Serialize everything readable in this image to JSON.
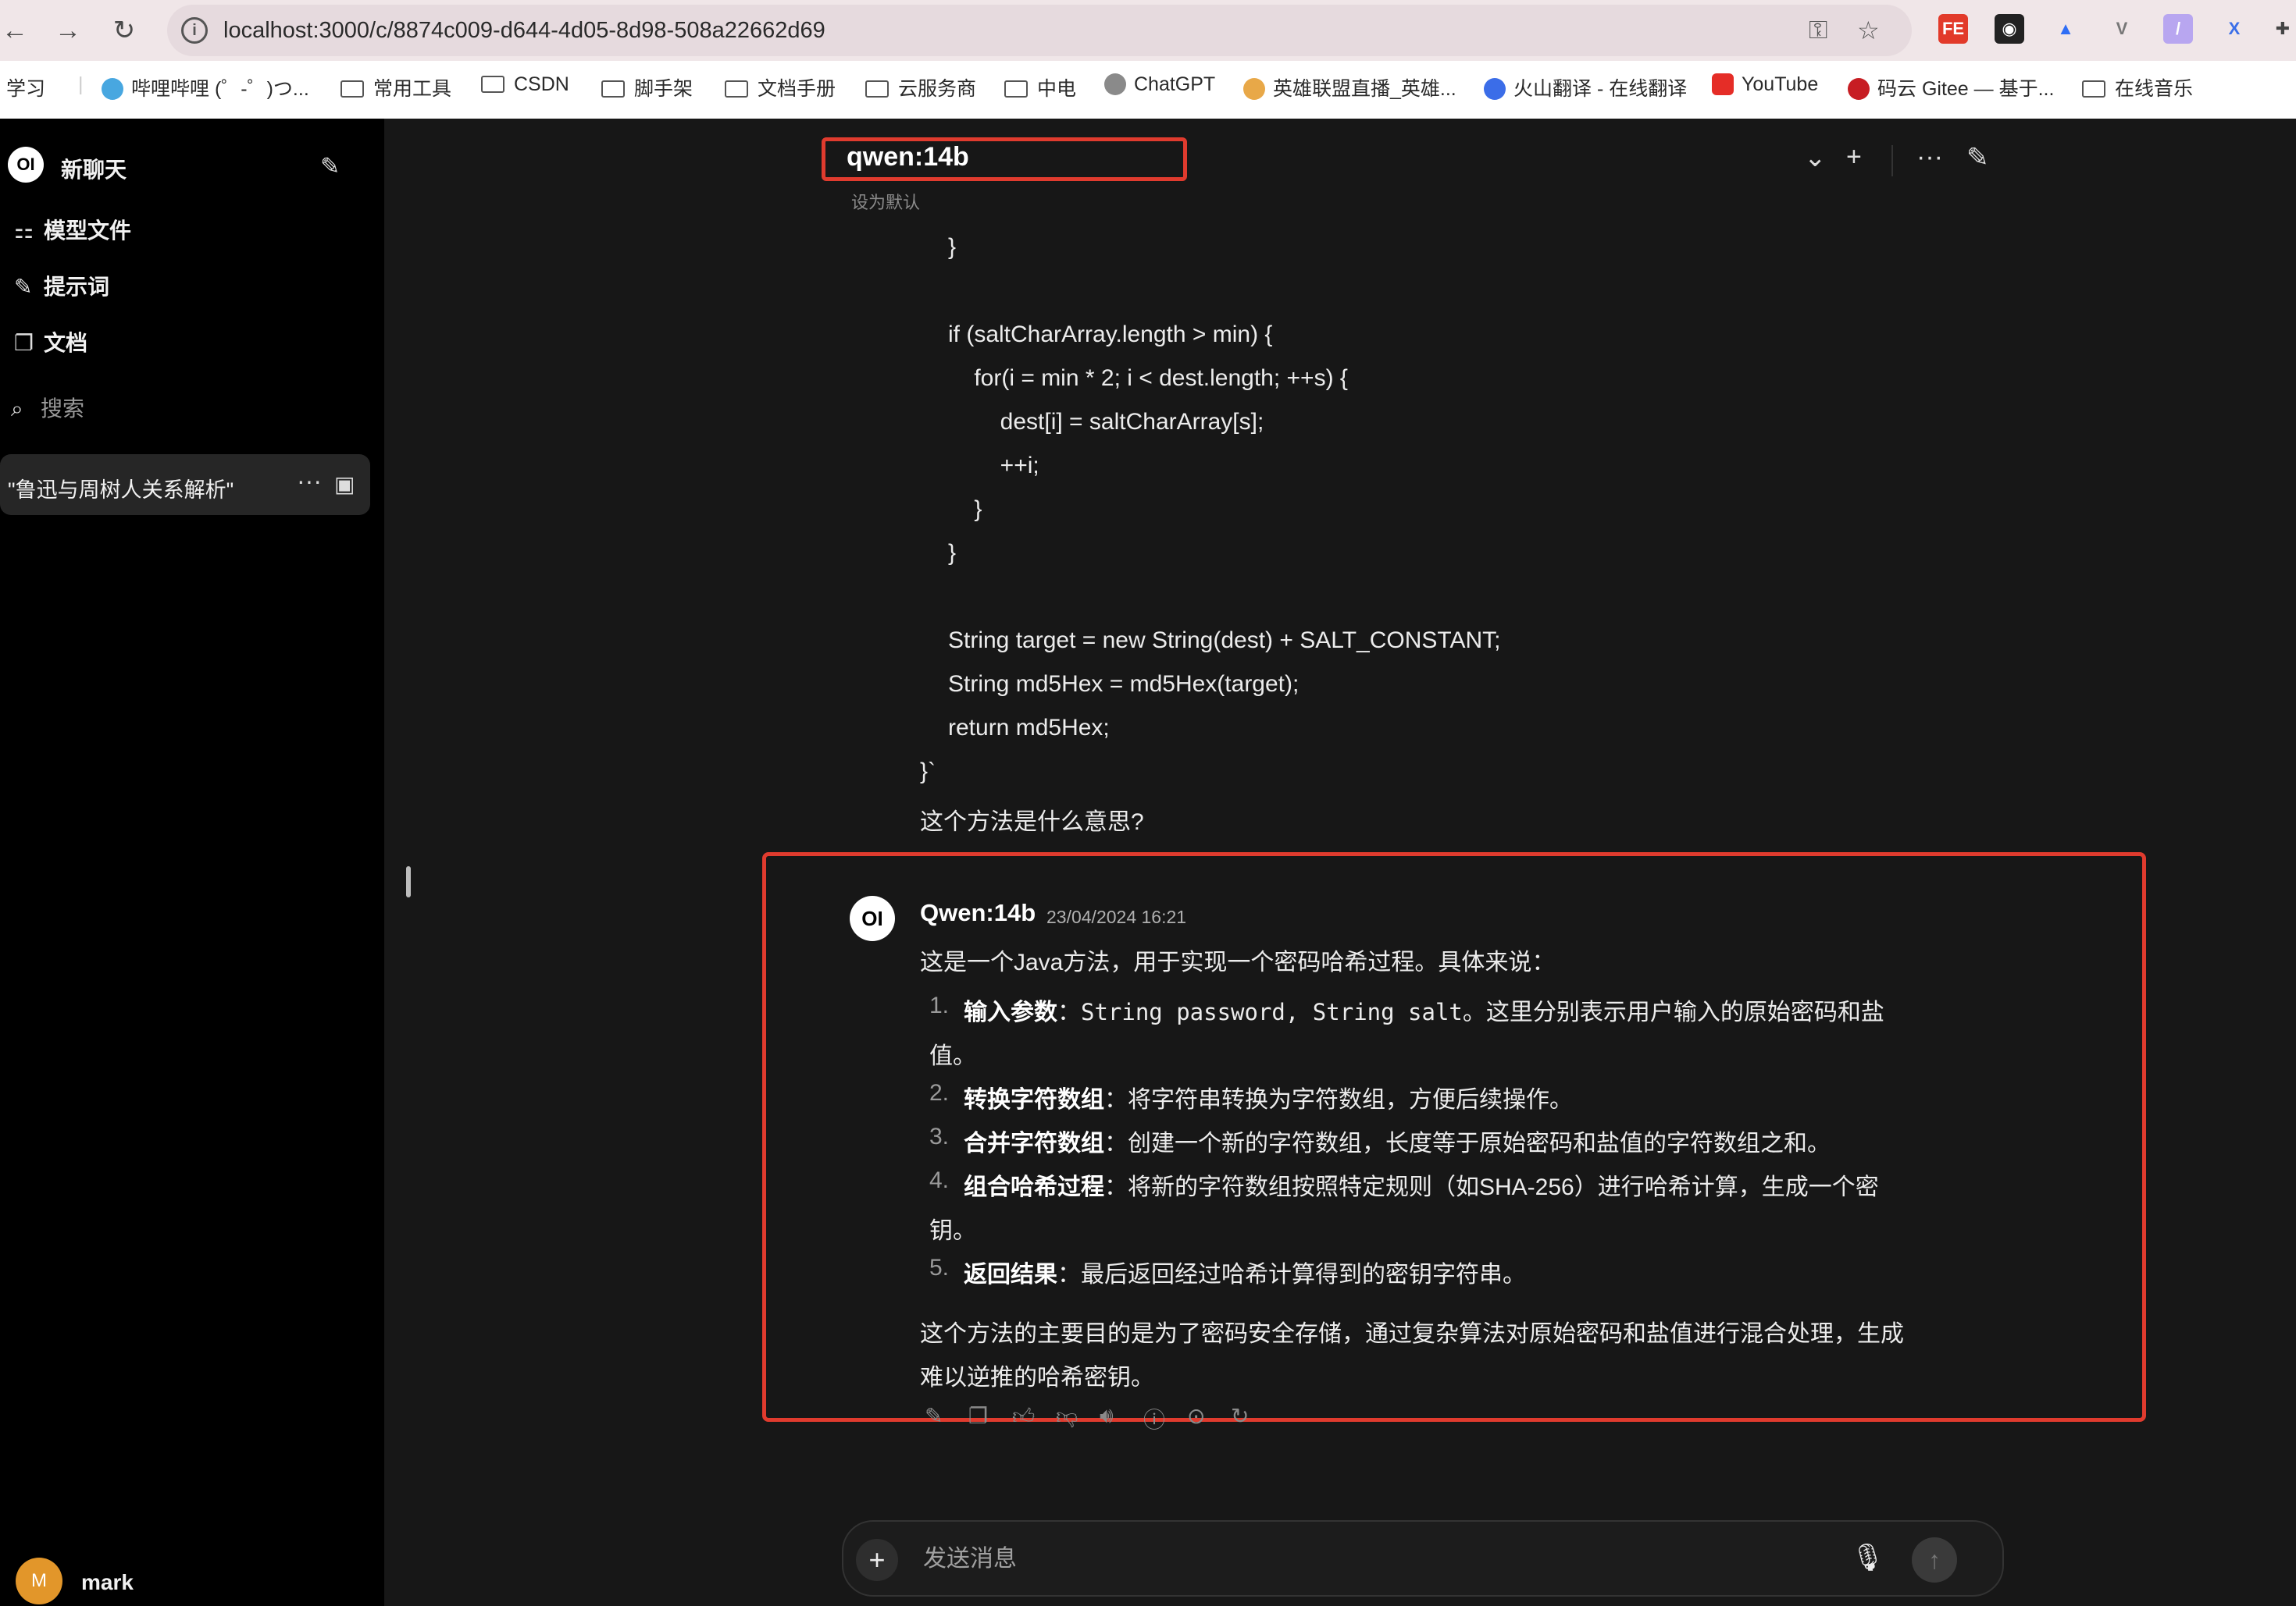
{
  "browser": {
    "url": "localhost:3000/c/8874c009-d644-4d05-8d98-508a22662d69",
    "bookmarks": [
      "学习",
      "哔哩哔哩 (゜-゜)つ...",
      "常用工具",
      "CSDN",
      "脚手架",
      "文档手册",
      "云服务商",
      "中电",
      "ChatGPT",
      "英雄联盟直播_英雄...",
      "火山翻译 - 在线翻译",
      "YouTube",
      "码云 Gitee — 基于...",
      "在线音乐"
    ]
  },
  "sidebar": {
    "new_chat": "新聊天",
    "items": [
      {
        "label": "模型文件",
        "icon": "grid-icon"
      },
      {
        "label": "提示词",
        "icon": "pencil-icon"
      },
      {
        "label": "文档",
        "icon": "document-icon"
      }
    ],
    "search_label": "搜索",
    "chats": [
      {
        "title": "\"鲁迅与周树人关系解析\""
      }
    ],
    "user": {
      "initial": "M",
      "name": "mark"
    }
  },
  "header": {
    "model": "qwen:14b",
    "set_default": "设为默认"
  },
  "user_message": {
    "code_lines": [
      "}",
      "",
      "if (saltCharArray.length > min) {",
      "    for(i = min * 2; i < dest.length; ++s) {",
      "        dest[i] = saltCharArray[s];",
      "        ++i;",
      "    }",
      "}",
      "",
      "String target = new String(dest) + SALT_CONSTANT;",
      "String md5Hex = md5Hex(target);",
      "return md5Hex;"
    ],
    "closing": "}`",
    "question": "这个方法是什么意思?"
  },
  "response": {
    "avatar": "OI",
    "name": "Qwen:14b",
    "time": "23/04/2024 16:21",
    "intro": "这是一个Java方法，用于实现一个密码哈希过程。具体来说：",
    "items": [
      {
        "num": "1.",
        "title": "输入参数",
        "sep": "：",
        "code": "String password, String salt",
        "text": "。这里分别表示用户输入的原始密码和盐",
        "cont": "值。"
      },
      {
        "num": "2.",
        "title": "转换字符数组",
        "sep": "：",
        "text": "将字符串转换为字符数组，方便后续操作。"
      },
      {
        "num": "3.",
        "title": "合并字符数组",
        "sep": "：",
        "text": "创建一个新的字符数组，长度等于原始密码和盐值的字符数组之和。"
      },
      {
        "num": "4.",
        "title": "组合哈希过程",
        "sep": "：",
        "text": "将新的字符数组按照特定规则（如SHA-256）进行哈希计算，生成一个密",
        "cont": "钥。"
      },
      {
        "num": "5.",
        "title": "返回结果",
        "sep": "：",
        "text": "最后返回经过哈希计算得到的密钥字符串。"
      }
    ],
    "summary_line1": "这个方法的主要目的是为了密码安全存储，通过复杂算法对原始密码和盐值进行混合处理，生成",
    "summary_line2": "难以逆推的哈希密钥。"
  },
  "composer": {
    "placeholder": "发送消息"
  },
  "colors": {
    "highlight": "#e03b2e",
    "background": "#171717",
    "sidebar": "#000000"
  }
}
